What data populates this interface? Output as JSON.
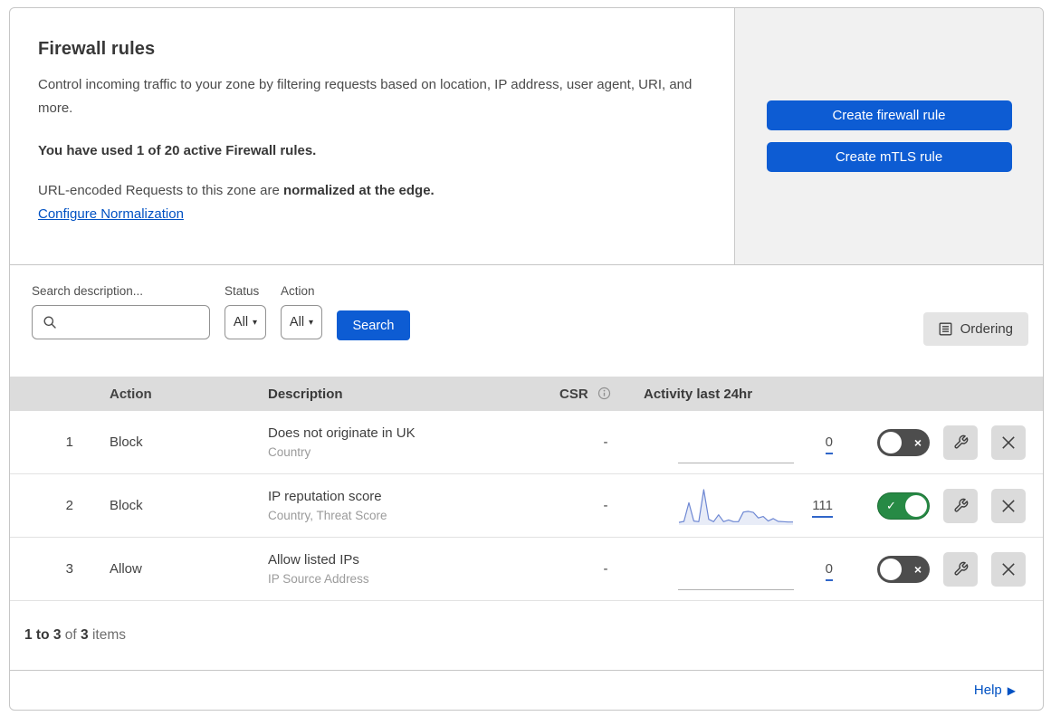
{
  "header": {
    "title": "Firewall rules",
    "description": "Control incoming traffic to your zone by filtering requests based on location, IP address, user agent, URI, and more.",
    "usage_notice": "You have used 1 of 20 active Firewall rules.",
    "normalization_prefix": "URL-encoded Requests to this zone are ",
    "normalization_bold": "normalized at the edge.",
    "normalization_link": "Configure Normalization",
    "create_firewall_button": "Create firewall rule",
    "create_mtls_button": "Create mTLS rule"
  },
  "filters": {
    "search_label": "Search description...",
    "status_label": "Status",
    "status_value": "All",
    "action_label": "Action",
    "action_value": "All",
    "search_button": "Search",
    "ordering_button": "Ordering"
  },
  "table": {
    "columns": {
      "action": "Action",
      "description": "Description",
      "csr": "CSR",
      "activity": "Activity last 24hr"
    },
    "rows": [
      {
        "num": "1",
        "action": "Block",
        "description": "Does not originate in UK",
        "fields": "Country",
        "csr": "-",
        "count": "0",
        "enabled": false
      },
      {
        "num": "2",
        "action": "Block",
        "description": "IP reputation score",
        "fields": "Country, Threat Score",
        "csr": "-",
        "count": "111",
        "enabled": true
      },
      {
        "num": "3",
        "action": "Allow",
        "description": "Allow listed IPs",
        "fields": "IP Source Address",
        "csr": "-",
        "count": "0",
        "enabled": false
      }
    ]
  },
  "chart_data": {
    "type": "area",
    "title": "Activity last 24hr sparkline (rule 2)",
    "x": "hours (last 24, relative)",
    "values": [
      5,
      8,
      62,
      9,
      7,
      100,
      14,
      7,
      27,
      7,
      12,
      7,
      7,
      35,
      37,
      34,
      18,
      22,
      9,
      16,
      8,
      7,
      6,
      6
    ],
    "total_events": 111,
    "ylim": [
      0,
      100
    ],
    "line_color": "#6d87d3",
    "fill_color": "rgba(125,150,210,0.18)"
  },
  "footer": {
    "range": "1 to 3",
    "of": " of ",
    "total": "3",
    "items": " items",
    "help": "Help"
  },
  "colors": {
    "primary_blue": "#0d5cd3",
    "link_blue": "#0051c3",
    "toggle_on_green": "#278a45",
    "toggle_off_gray": "#4d4d4d",
    "header_row_gray": "#dcdcdc",
    "panel_gray": "#f1f1f1"
  }
}
